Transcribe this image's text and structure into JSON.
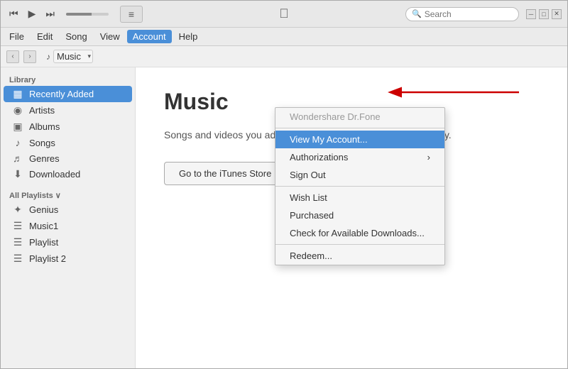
{
  "titlebar": {
    "transport": {
      "rewind": "⏮",
      "play": "▶",
      "forward": "⏭"
    },
    "apple_logo": "",
    "window_buttons": {
      "minimize": "─",
      "maximize": "□",
      "close": "✕"
    },
    "list_btn": "≡",
    "search_placeholder": "Search"
  },
  "menubar": {
    "items": [
      "File",
      "Edit",
      "Song",
      "View",
      "Account",
      "Help"
    ]
  },
  "navbar": {
    "back": "‹",
    "forward": "›",
    "note_icon": "♪",
    "music_label": "Music",
    "dropdown_arrow": "▾"
  },
  "sidebar": {
    "library_label": "Library",
    "library_items": [
      {
        "id": "recently-added",
        "icon": "▦",
        "label": "Recently Added",
        "active": true
      },
      {
        "id": "artists",
        "icon": "👤",
        "label": "Artists"
      },
      {
        "id": "albums",
        "icon": "▣",
        "label": "Albums"
      },
      {
        "id": "songs",
        "icon": "♪",
        "label": "Songs"
      },
      {
        "id": "genres",
        "icon": "♬",
        "label": "Genres"
      },
      {
        "id": "downloaded",
        "icon": "⬇",
        "label": "Downloaded"
      }
    ],
    "playlists_label": "All Playlists ∨",
    "playlist_items": [
      {
        "id": "genius",
        "icon": "✦",
        "label": "Genius"
      },
      {
        "id": "music1",
        "icon": "☰",
        "label": "Music1"
      },
      {
        "id": "playlist",
        "icon": "☰",
        "label": "Playlist"
      },
      {
        "id": "playlist2",
        "icon": "☰",
        "label": "Playlist 2"
      }
    ]
  },
  "content": {
    "title": "Music",
    "description": "Songs and videos you add to iTunes appear in your music library.",
    "button_label": "Go to the iTunes Store"
  },
  "account_menu": {
    "user": "Wondershare Dr.Fone",
    "items": [
      {
        "id": "view-account",
        "label": "View My Account...",
        "highlighted": true,
        "has_arrow": false
      },
      {
        "id": "authorizations",
        "label": "Authorizations",
        "has_arrow": true
      },
      {
        "id": "sign-out",
        "label": "Sign Out",
        "has_arrow": false
      }
    ],
    "section2": [
      {
        "id": "wish-list",
        "label": "Wish List"
      },
      {
        "id": "purchased",
        "label": "Purchased"
      },
      {
        "id": "check-downloads",
        "label": "Check for Available Downloads..."
      }
    ],
    "section3": [
      {
        "id": "redeem",
        "label": "Redeem..."
      }
    ]
  }
}
